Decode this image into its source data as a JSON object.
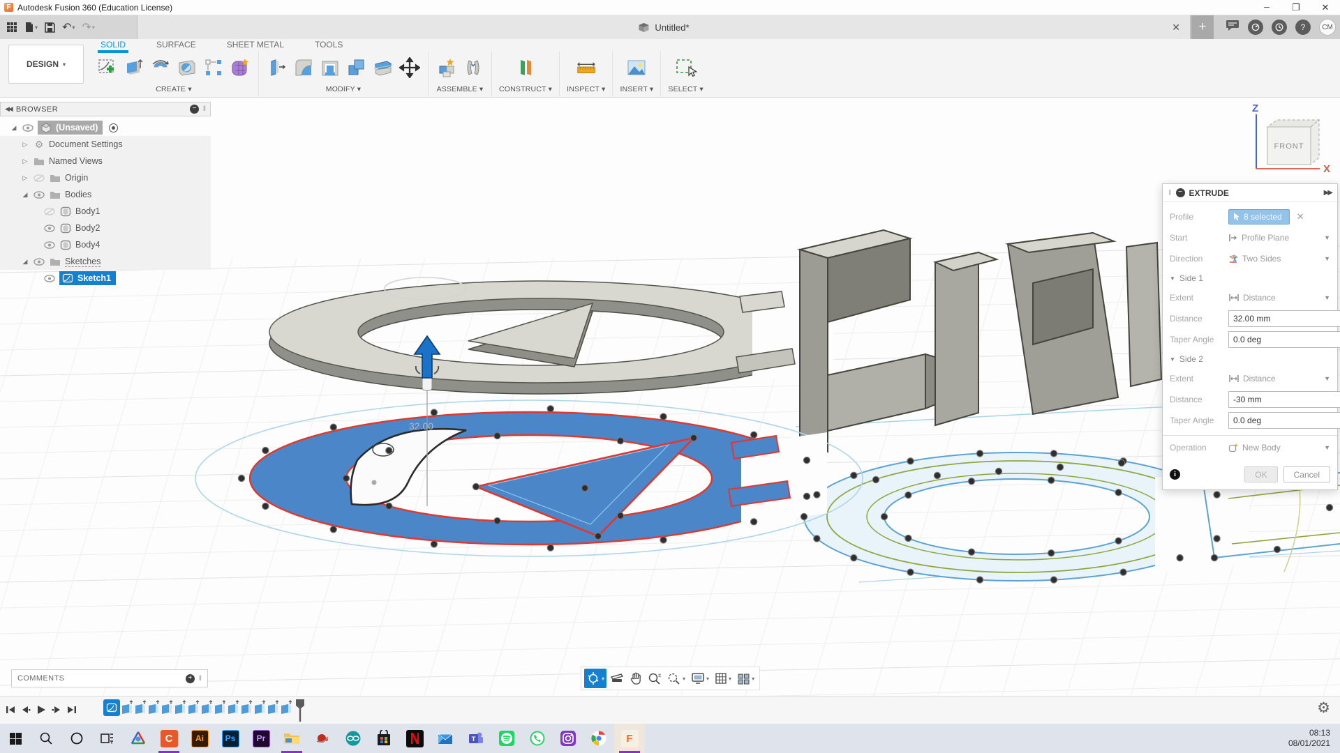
{
  "window": {
    "title": "Autodesk Fusion 360 (Education License)"
  },
  "appbar": {
    "tab_title": "Untitled*",
    "avatar": "CM"
  },
  "ribbon": {
    "design_label": "DESIGN",
    "tabs": [
      {
        "label": "SOLID",
        "active": true
      },
      {
        "label": "SURFACE",
        "active": false
      },
      {
        "label": "SHEET METAL",
        "active": false
      },
      {
        "label": "TOOLS",
        "active": false
      }
    ],
    "groups": [
      {
        "label": "CREATE",
        "icons": [
          "create-sketch",
          "extrude",
          "revolve",
          "hole",
          "rectangular-pattern",
          "create-form"
        ]
      },
      {
        "label": "MODIFY",
        "icons": [
          "press-pull",
          "fillet",
          "shell",
          "combine",
          "split-body",
          "move-copy"
        ]
      },
      {
        "label": "ASSEMBLE",
        "icons": [
          "new-component",
          "joint"
        ]
      },
      {
        "label": "CONSTRUCT",
        "icons": [
          "offset-plane"
        ]
      },
      {
        "label": "INSPECT",
        "icons": [
          "measure"
        ]
      },
      {
        "label": "INSERT",
        "icons": [
          "insert-image"
        ]
      },
      {
        "label": "SELECT",
        "icons": [
          "select-window"
        ]
      }
    ]
  },
  "browser": {
    "header": "BROWSER",
    "items": [
      {
        "label": "(Unsaved)",
        "icon": "component-cube",
        "state": "expanded",
        "active_component": true
      },
      {
        "label": "Document Settings",
        "icon": "gear",
        "state": "collapsed"
      },
      {
        "label": "Named Views",
        "icon": "folder",
        "state": "collapsed"
      },
      {
        "label": "Origin",
        "icon": "folder",
        "state": "collapsed",
        "visible": false
      },
      {
        "label": "Bodies",
        "icon": "folder",
        "state": "expanded",
        "visible": true
      },
      {
        "label": "Body1",
        "icon": "body",
        "visible": false
      },
      {
        "label": "Body2",
        "icon": "body",
        "visible": true
      },
      {
        "label": "Body4",
        "icon": "body",
        "visible": true
      },
      {
        "label": "Sketches",
        "icon": "folder",
        "state": "expanded",
        "visible": true,
        "editing": true
      },
      {
        "label": "Sketch1",
        "icon": "sketch",
        "visible": true,
        "selected": true
      }
    ]
  },
  "extrude_dialog": {
    "title": "EXTRUDE",
    "profile_label": "Profile",
    "profile_value": "8 selected",
    "start_label": "Start",
    "start_value": "Profile Plane",
    "direction_label": "Direction",
    "direction_value": "Two Sides",
    "side1_label": "Side 1",
    "side2_label": "Side 2",
    "extent_label": "Extent",
    "extent_value": "Distance",
    "distance_label": "Distance",
    "side1_distance": "32.00 mm",
    "side1_taper": "0.0 deg",
    "side2_distance": "-30 mm",
    "side2_taper": "0.0 deg",
    "taper_label": "Taper Angle",
    "operation_label": "Operation",
    "operation_value": "New Body",
    "ok_label": "OK",
    "cancel_label": "Cancel"
  },
  "viewport": {
    "viewcube_face": "FRONT",
    "axis_z": "Z",
    "axis_x": "X",
    "dimension_label": "32.00",
    "navbar_icons": [
      "orbit",
      "look-at",
      "pan",
      "zoom",
      "fit",
      "display-settings",
      "grid-settings",
      "viewports"
    ]
  },
  "comments": {
    "label": "COMMENTS"
  },
  "timeline": {
    "sketch_count": 1,
    "extrude_count": 13
  },
  "taskbar": {
    "time": "08:13",
    "date": "08/01/2021",
    "icons": [
      "start",
      "search",
      "cortana",
      "task-view",
      "3d-viewer",
      "camtasia",
      "illustrator",
      "photoshop",
      "premiere",
      "file-explorer",
      "orbit-red",
      "arduino",
      "microsoft-store",
      "netflix",
      "mail",
      "teams",
      "spotify",
      "whatsapp",
      "instagram",
      "chrome",
      "fusion-360"
    ]
  },
  "colors": {
    "accent": "#0696d7",
    "selection": "#1580d0",
    "profile_fill": "#4a86c8",
    "highlight_red": "#e2372c",
    "sketch_teal": "#5ba3d0",
    "sketch_green": "#8fa63f",
    "taskbar_accent": "#8b2fc9"
  }
}
